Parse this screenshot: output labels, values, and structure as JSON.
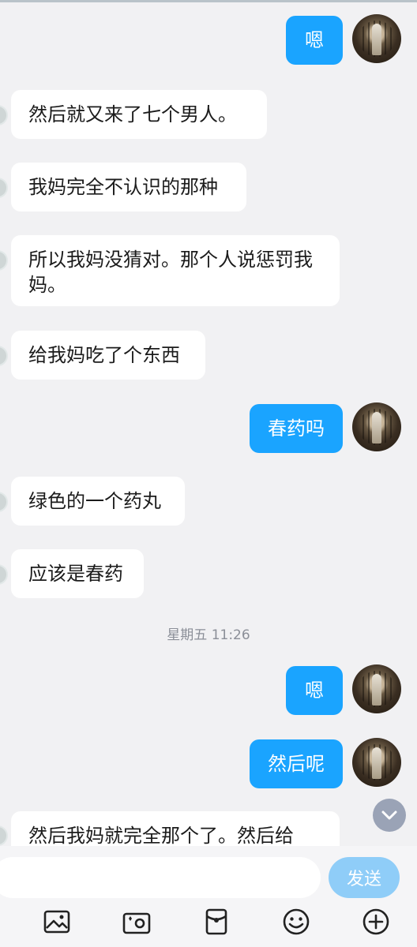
{
  "messages": [
    {
      "side": "out",
      "text": "嗯"
    },
    {
      "side": "in",
      "text": "然后就又来了七个男人。"
    },
    {
      "side": "in",
      "text": "我妈完全不认识的那种"
    },
    {
      "side": "in",
      "text": "所以我妈没猜对。那个人说惩罚我妈。"
    },
    {
      "side": "in",
      "text": "给我妈吃了个东西"
    },
    {
      "side": "out",
      "text": "春药吗"
    },
    {
      "side": "in",
      "text": "绿色的一个药丸"
    },
    {
      "side": "in",
      "text": "应该是春药"
    },
    {
      "side": "out",
      "text": "嗯"
    },
    {
      "side": "out",
      "text": "然后呢"
    },
    {
      "side": "in",
      "text": "然后我妈就完全那个了。然后给"
    }
  ],
  "timestamp": "星期五 11:26",
  "input": {
    "placeholder": "",
    "send_label": "发送"
  },
  "toolbar": [
    "image-icon",
    "camera-icon",
    "red-packet-icon",
    "emoji-icon",
    "plus-icon"
  ],
  "colors": {
    "outgoing": "#1aa4ff",
    "incoming": "#ffffff",
    "send": "#8fcdf8"
  }
}
